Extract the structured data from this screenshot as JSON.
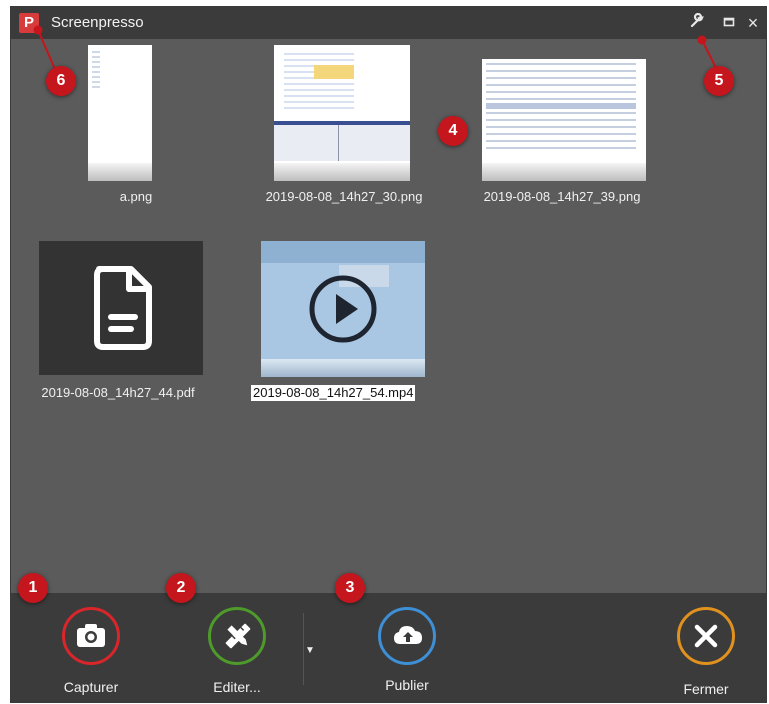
{
  "window": {
    "title": "Screenpresso",
    "logo_letter": "P"
  },
  "titlebar": {
    "settings_icon": "wrench-icon",
    "maximize_icon": "maximize-icon",
    "close_glyph": "×"
  },
  "files": [
    {
      "name": "a.png",
      "type": "png"
    },
    {
      "name": "2019-08-08_14h27_30.png",
      "type": "png"
    },
    {
      "name": "2019-08-08_14h27_39.png",
      "type": "png"
    },
    {
      "name": "2019-08-08_14h27_44.pdf",
      "type": "pdf"
    },
    {
      "name": "2019-08-08_14h27_54.mp4",
      "type": "mp4",
      "selected": true
    }
  ],
  "callouts": [
    "1",
    "2",
    "3",
    "4",
    "5",
    "6"
  ],
  "actions": {
    "capture": {
      "label": "Capturer",
      "color": "#d8262b",
      "icon": "camera-icon"
    },
    "edit": {
      "label": "Editer...",
      "color": "#4e9a2a",
      "icon": "edit-tools-icon"
    },
    "publish": {
      "label": "Publier",
      "color": "#3e8fd6",
      "icon": "cloud-upload-icon"
    },
    "close": {
      "label": "Fermer",
      "color": "#e0911e",
      "icon": "close-x-icon"
    }
  },
  "dropdown_glyph": "▼",
  "colors": {
    "background": "#5b5b5b",
    "bars": "#3b3b3b",
    "badge": "#c4161c"
  }
}
